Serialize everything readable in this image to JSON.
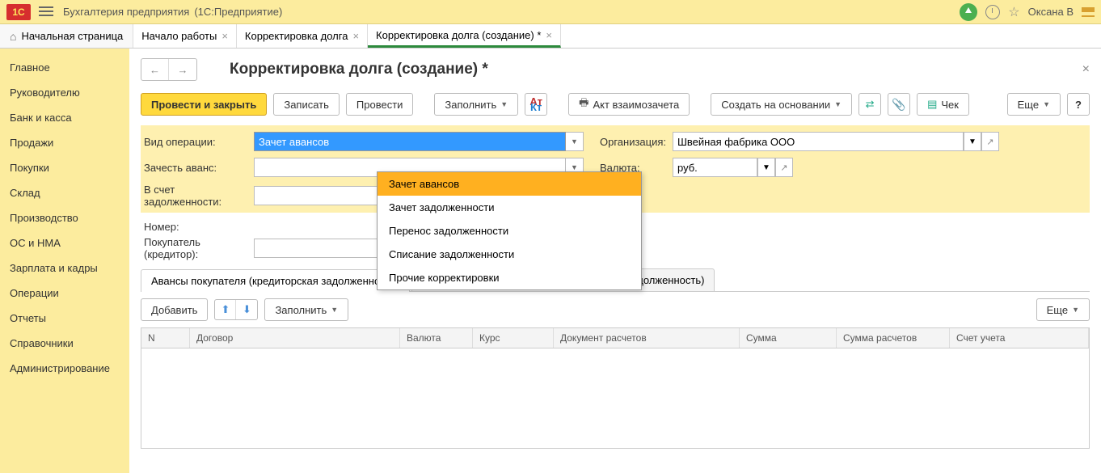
{
  "titlebar": {
    "app_name": "Бухгалтерия предприятия",
    "platform": "(1С:Предприятие)",
    "user": "Оксана В"
  },
  "tabs": {
    "home": "Начальная страница",
    "items": [
      {
        "label": "Начало работы"
      },
      {
        "label": "Корректировка долга"
      },
      {
        "label": "Корректировка долга (создание) *",
        "active": true
      }
    ]
  },
  "sidebar": {
    "items": [
      {
        "label": "Главное"
      },
      {
        "label": "Руководителю"
      },
      {
        "label": "Банк и касса"
      },
      {
        "label": "Продажи"
      },
      {
        "label": "Покупки"
      },
      {
        "label": "Склад"
      },
      {
        "label": "Производство"
      },
      {
        "label": "ОС и НМА"
      },
      {
        "label": "Зарплата и кадры"
      },
      {
        "label": "Операции"
      },
      {
        "label": "Отчеты"
      },
      {
        "label": "Справочники"
      },
      {
        "label": "Администрирование"
      }
    ]
  },
  "page": {
    "title": "Корректировка долга (создание) *"
  },
  "toolbar": {
    "post_close": "Провести и закрыть",
    "write": "Записать",
    "post": "Провести",
    "fill": "Заполнить",
    "act": "Акт взаимозачета",
    "create_based": "Создать на основании",
    "check": "Чек",
    "more": "Еще",
    "help": "?"
  },
  "form": {
    "op_type_label": "Вид операции:",
    "op_type_value": "Зачет авансов",
    "advance_label": "Зачесть аванс:",
    "debt_label": "В счет задолженности:",
    "number_label": "Номер:",
    "buyer_label": "Покупатель (кредитор):",
    "org_label": "Организация:",
    "org_value": "Швейная фабрика ООО",
    "currency_label": "Валюта:",
    "currency_value": "руб."
  },
  "dropdown": {
    "items": [
      "Зачет авансов",
      "Зачет задолженности",
      "Перенос задолженности",
      "Списание задолженности",
      "Прочие корректировки"
    ]
  },
  "subtabs": {
    "items": [
      {
        "label": "Авансы покупателя (кредиторская задолженность)",
        "active": true
      },
      {
        "label": "Задолженность покупателя (дебиторская задолженность)"
      }
    ]
  },
  "subtoolbar": {
    "add": "Добавить",
    "fill": "Заполнить",
    "more": "Еще"
  },
  "table": {
    "cols": {
      "n": "N",
      "dogovor": "Договор",
      "valuta": "Валюта",
      "kurs": "Курс",
      "doc": "Документ расчетов",
      "summa": "Сумма",
      "summar": "Сумма расчетов",
      "acc": "Счет учета"
    }
  }
}
